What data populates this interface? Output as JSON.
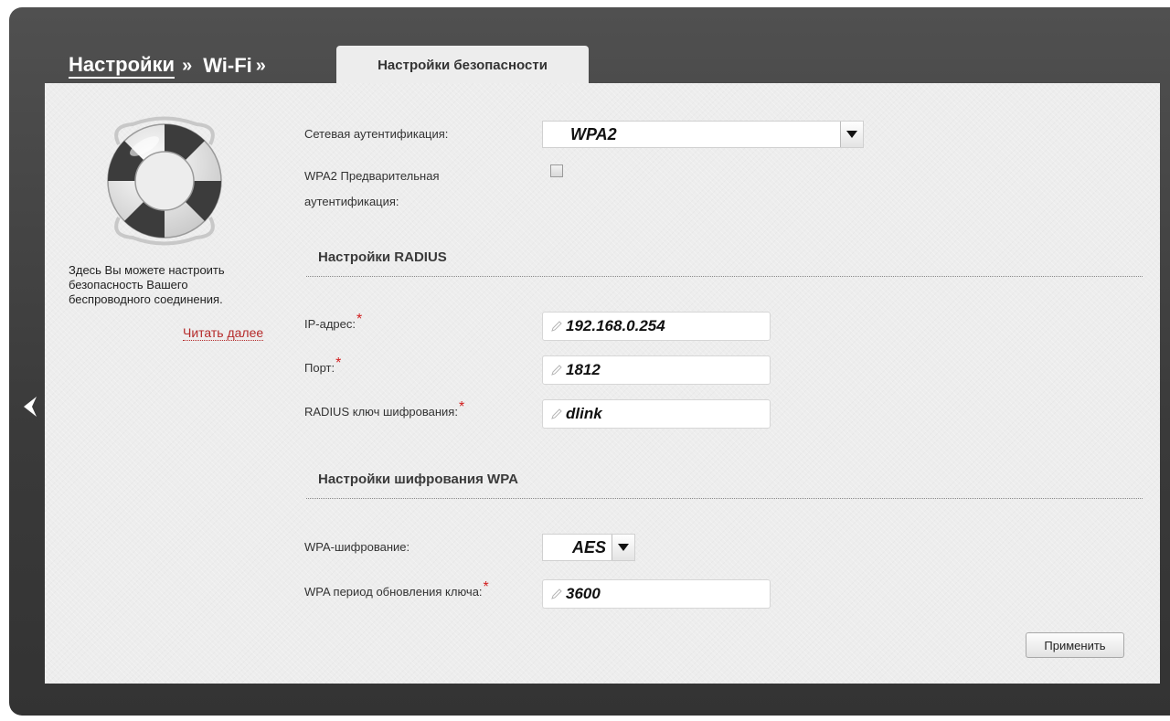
{
  "breadcrumb": {
    "items": [
      {
        "label": "Настройки",
        "separator": "»"
      },
      {
        "label": "Wi-Fi",
        "separator": "»"
      }
    ]
  },
  "tab": {
    "label": "Настройки безопасности"
  },
  "sidebar": {
    "description": "Здесь Вы можете настроить безопасность Вашего беспроводного соединения.",
    "read_more": "Читать далее",
    "icon": "lifebuoy-icon"
  },
  "form": {
    "auth_label": "Сетевая аутентификация:",
    "auth_value": "WPA2",
    "preauth_label_line1": "WPA2 Предварительная",
    "preauth_label_line2": "аутентификация:",
    "preauth_checked": false,
    "radius_title": "Настройки RADIUS",
    "ip_label": "IP-адрес:",
    "ip_value": "192.168.0.254",
    "port_label": "Порт:",
    "port_value": "1812",
    "key_label": "RADIUS ключ шифрования:",
    "key_value": "dlink",
    "wpa_title": "Настройки шифрования WPA",
    "wpa_enc_label": "WPA-шифрование:",
    "wpa_enc_value": "AES",
    "wpa_period_label": "WPA период обновления ключа:",
    "wpa_period_value": "3600",
    "required_mark": "*"
  },
  "buttons": {
    "apply": "Применить"
  },
  "colors": {
    "frame_dark": "#3a3a3a",
    "panel_bg": "#ededed",
    "required": "#d11d1d",
    "read_more": "#b52a2a"
  }
}
